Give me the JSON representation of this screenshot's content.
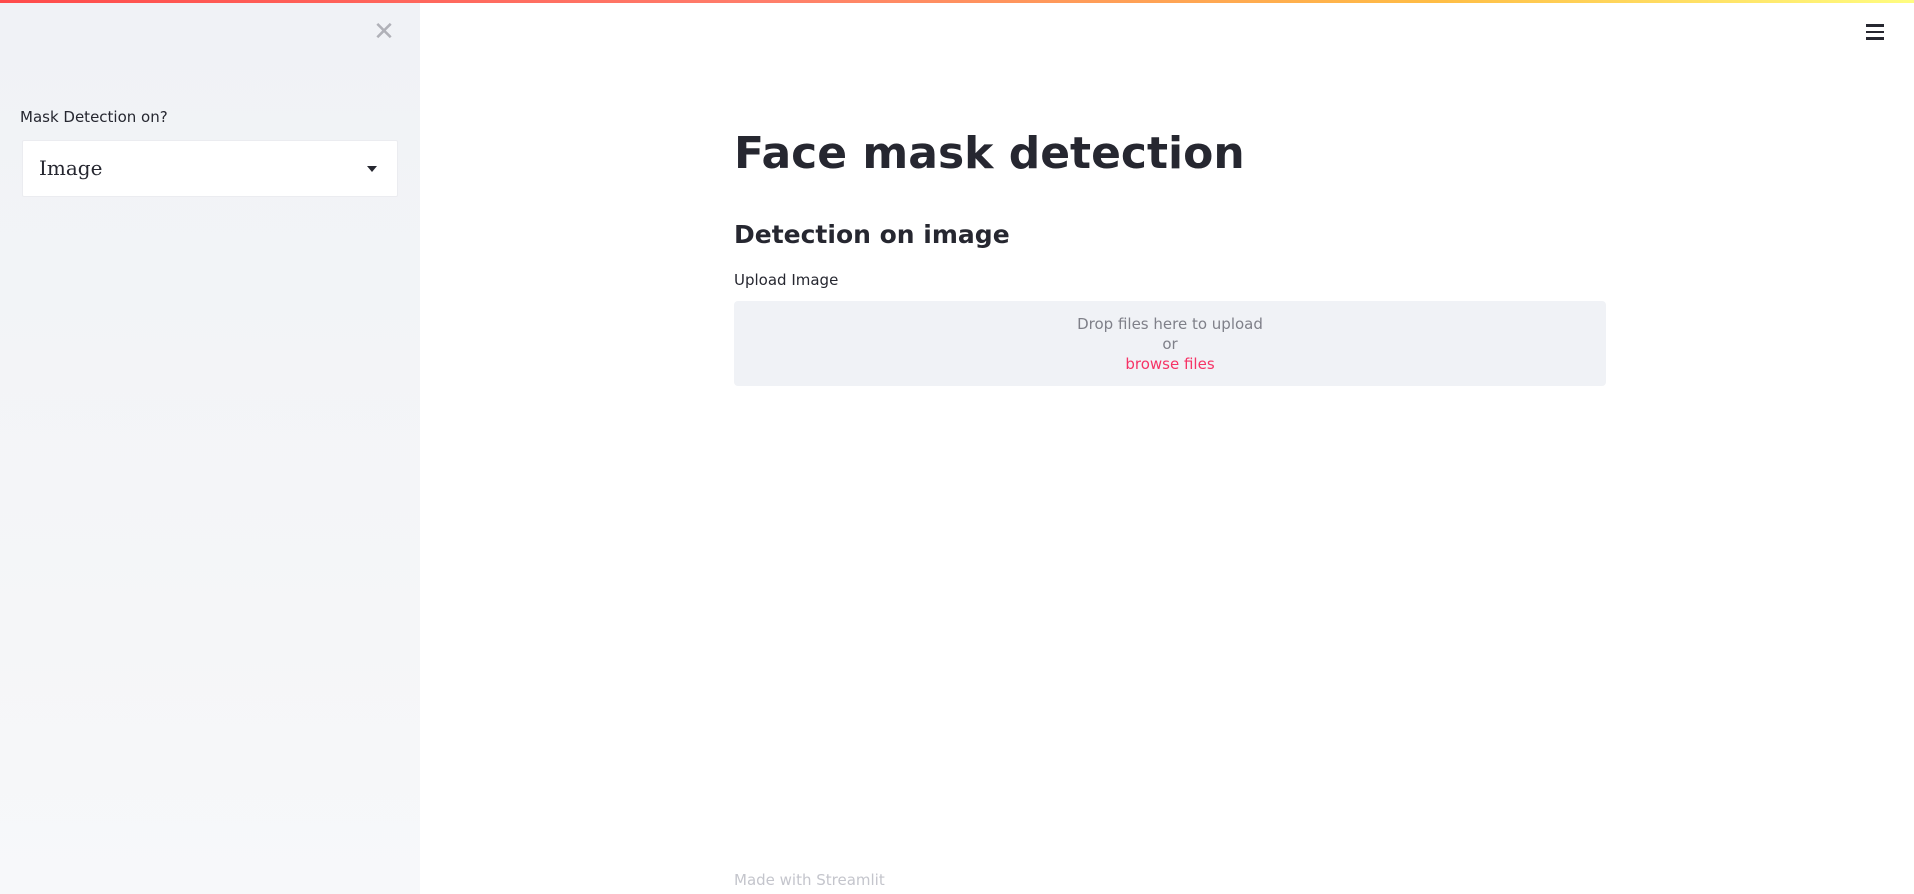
{
  "app": {
    "accent_color": "#f63366",
    "decoration_gradient": [
      "#ff4b4b",
      "#ffbd45",
      "#fffd80"
    ]
  },
  "sidebar": {
    "close_icon": "close-icon",
    "close_glyph": "✕",
    "select_label": "Mask Detection on?",
    "select_value": "Image"
  },
  "header": {
    "menu_icon": "hamburger-menu-icon"
  },
  "main": {
    "title": "Face mask detection",
    "subheading": "Detection on image",
    "uploader": {
      "label": "Upload Image",
      "drop_text": "Drop files here to upload",
      "or_text": "or",
      "browse_text": "browse files"
    },
    "footer": "Made with Streamlit"
  }
}
